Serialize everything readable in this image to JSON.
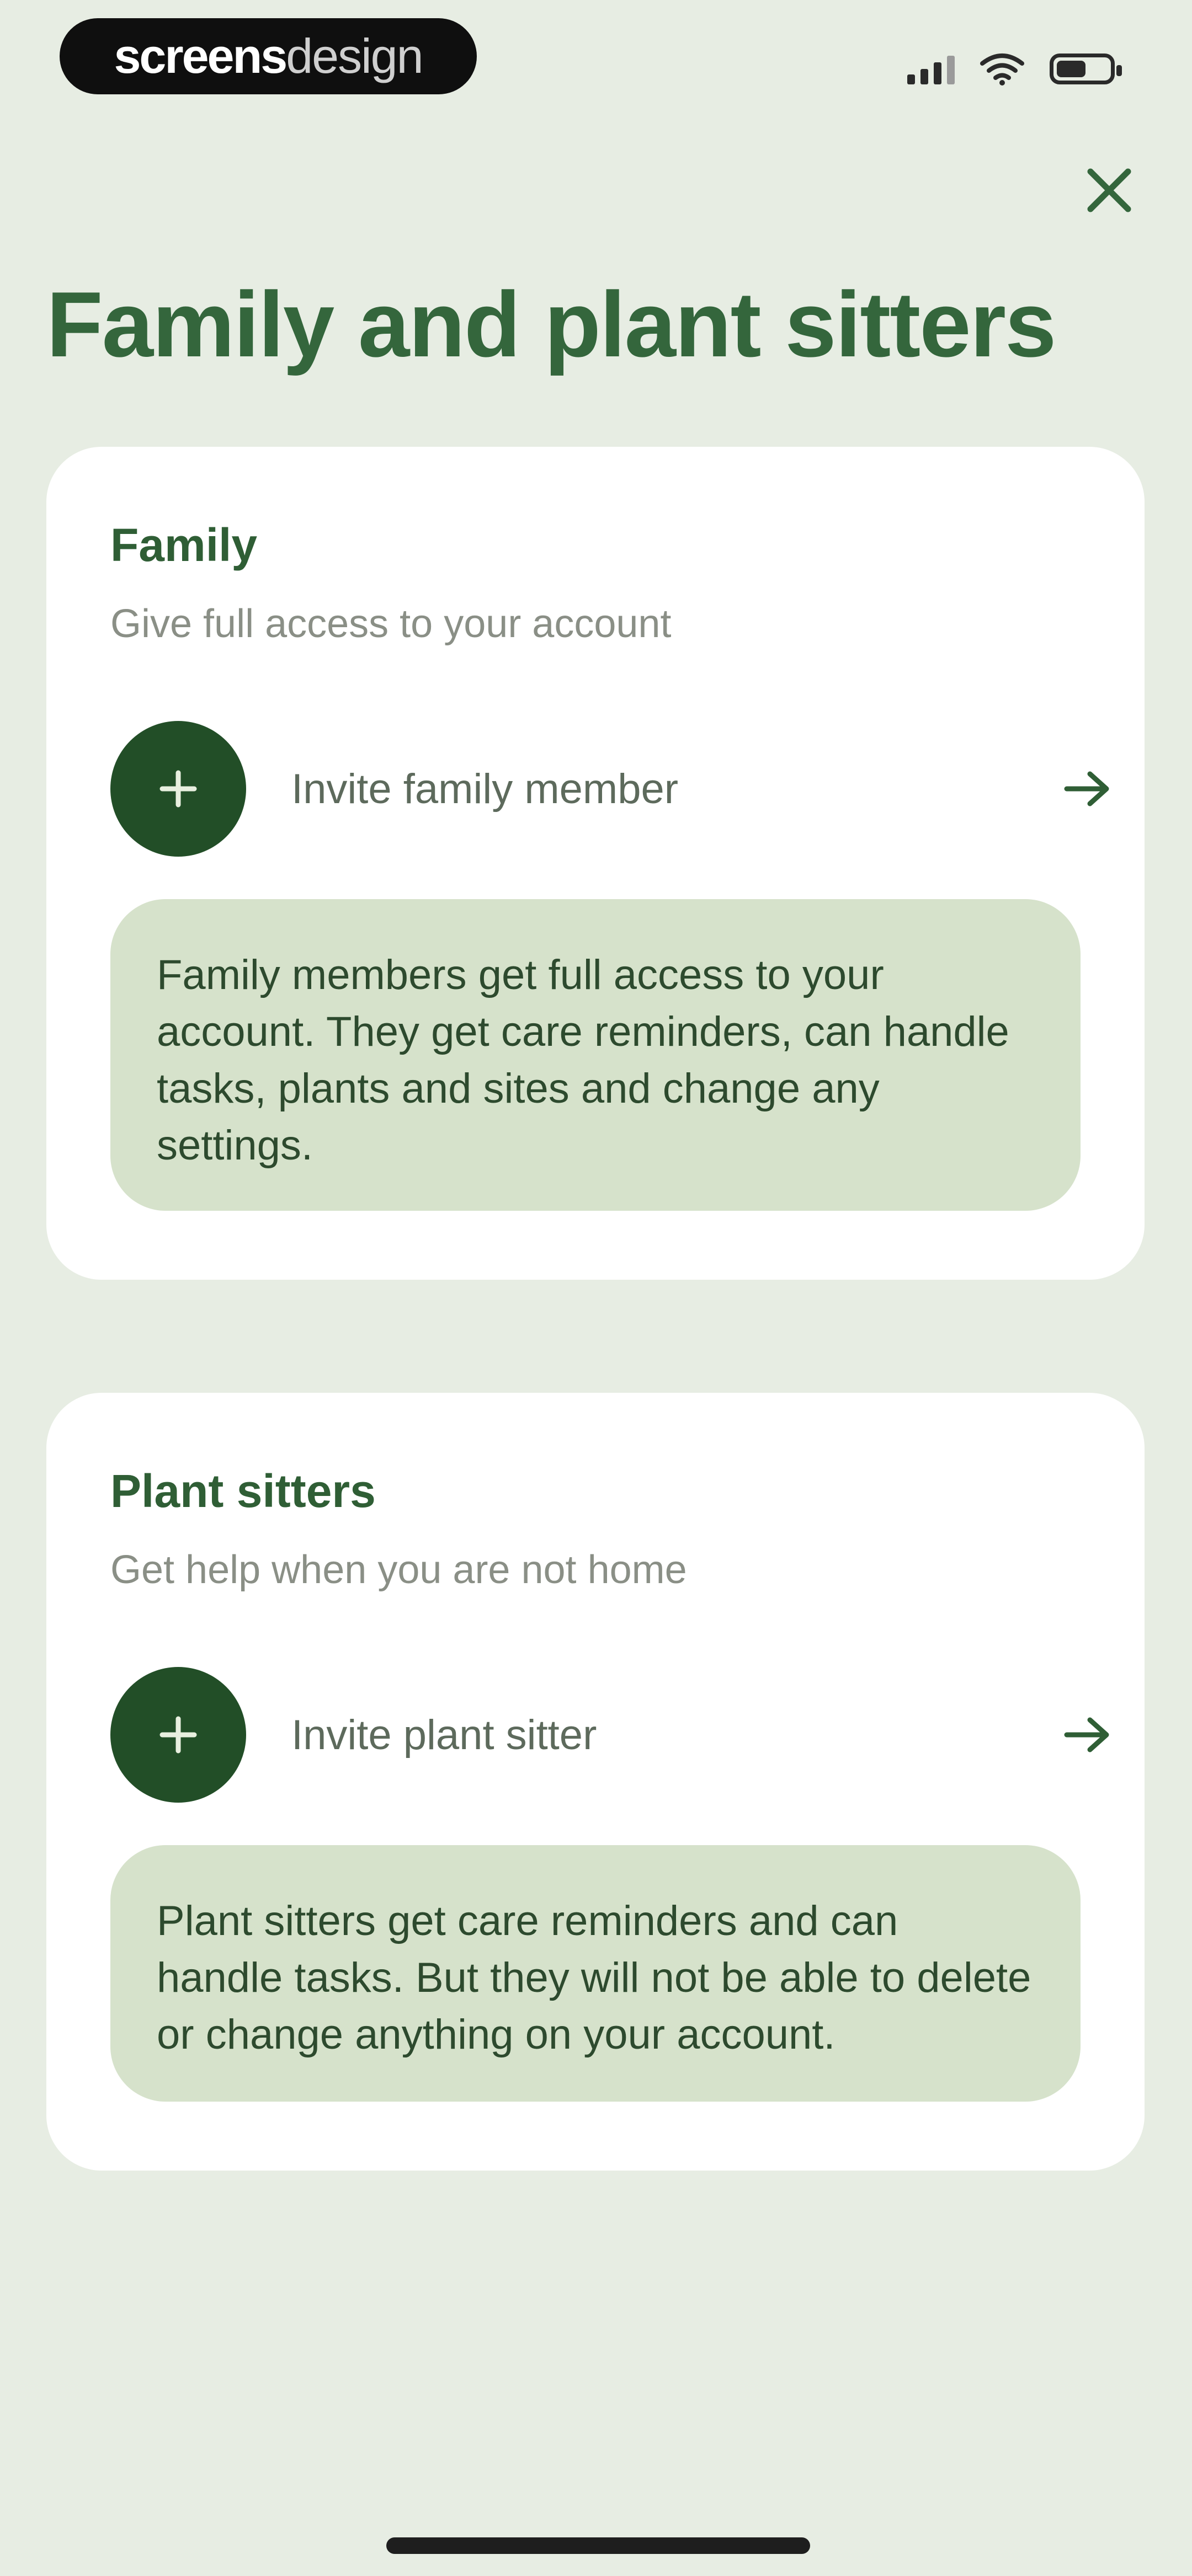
{
  "status_bar": {
    "brand_bold": "screens",
    "brand_light": "design"
  },
  "header": {
    "title": "Family and plant sitters",
    "close_icon": "close-icon"
  },
  "family": {
    "title": "Family",
    "subtitle": "Give full access to your account",
    "invite_label": "Invite family member",
    "info": "Family members get full access to your account. They get care reminders, can handle tasks, plants and sites and change any settings."
  },
  "sitters": {
    "title": "Plant sitters",
    "subtitle": "Get help when you are not home",
    "invite_label": "Invite plant sitter",
    "info": "Plant sitters get care reminders and can handle tasks. But they will not be able to delete or change anything on your account."
  },
  "colors": {
    "background": "#e7ede3",
    "title_green": "#34663c",
    "button_green": "#224e27",
    "info_box": "#d6e2cb",
    "card": "#ffffff"
  }
}
